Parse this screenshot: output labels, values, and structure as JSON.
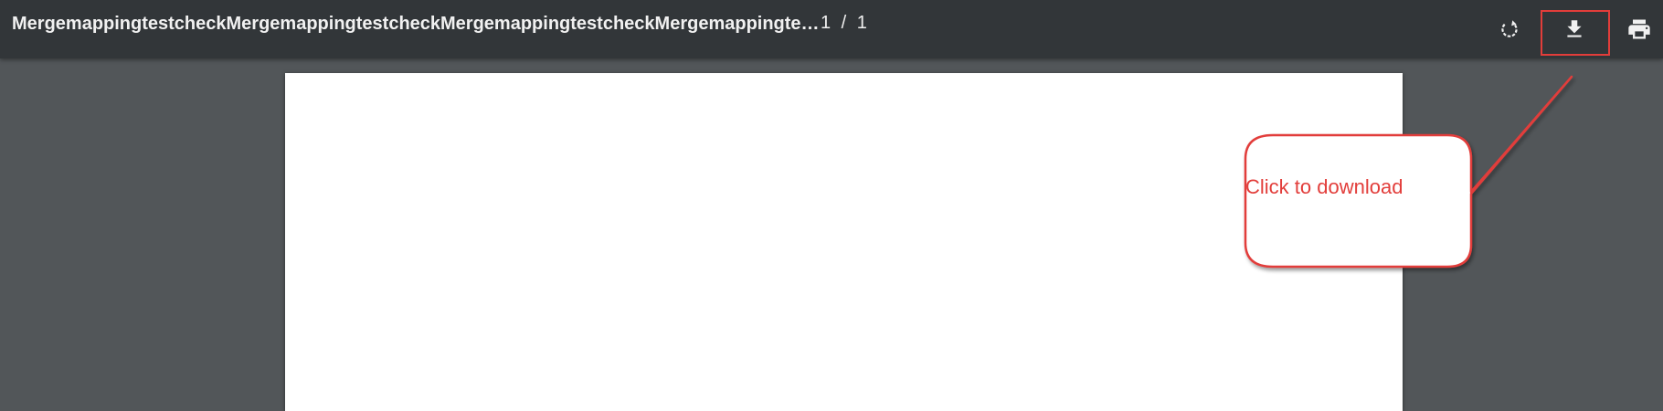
{
  "toolbar": {
    "title": "MergemappingtestcheckMergemappingtestcheckMergemappingtestcheckMergemappingte…",
    "page_counter": "1 / 1",
    "buttons": {
      "rotate": {
        "icon": "rotate-icon"
      },
      "download": {
        "icon": "download-icon"
      },
      "print": {
        "icon": "print-icon"
      }
    }
  },
  "annotation": {
    "text": "Click to download",
    "color": "#e23d3a"
  },
  "colors": {
    "toolbar_bg": "#323639",
    "viewer_bg": "#525659",
    "page_bg": "#ffffff"
  }
}
